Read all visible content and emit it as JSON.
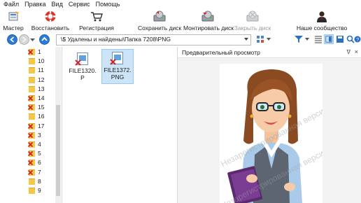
{
  "menu": {
    "items": [
      "Файл",
      "Правка",
      "Вид",
      "Сервис",
      "Помощь"
    ]
  },
  "toolbar": {
    "buttons": [
      {
        "label": "Мастер",
        "icon": "wizard-icon"
      },
      {
        "label": "Восстановить",
        "icon": "lifebuoy-icon"
      },
      {
        "label": "Регистрация",
        "icon": "cart-icon"
      },
      {
        "label": "Сохранить диск",
        "icon": "save-disk-icon"
      },
      {
        "label": "Монтировать диск",
        "icon": "mount-disk-icon"
      },
      {
        "label": "Закрыть диск",
        "icon": "close-disk-icon"
      },
      {
        "label": "Наше сообщество",
        "icon": "community-icon"
      }
    ]
  },
  "address": {
    "path": "\\$ Удалены и найдены\\Папка 7208\\PNG"
  },
  "tree": {
    "items": [
      {
        "label": "1",
        "deleted": true
      },
      {
        "label": "10",
        "deleted": false
      },
      {
        "label": "11",
        "deleted": false
      },
      {
        "label": "12",
        "deleted": false
      },
      {
        "label": "13",
        "deleted": false
      },
      {
        "label": "14",
        "deleted": true
      },
      {
        "label": "15",
        "deleted": true
      },
      {
        "label": "16",
        "deleted": false
      },
      {
        "label": "17",
        "deleted": true
      },
      {
        "label": "3",
        "deleted": true
      },
      {
        "label": "4",
        "deleted": true
      },
      {
        "label": "5",
        "deleted": true
      },
      {
        "label": "6",
        "deleted": true
      },
      {
        "label": "7",
        "deleted": true
      },
      {
        "label": "8",
        "deleted": false
      },
      {
        "label": "9",
        "deleted": false
      }
    ]
  },
  "files": [
    {
      "name": "FILE1320.P",
      "selected": false
    },
    {
      "name": "FILE1372.PNG",
      "selected": true
    }
  ],
  "preview": {
    "title": "Предварительный просмотр",
    "pin": "ᐁ",
    "close": "×",
    "watermark": "Незарегистрированная версия"
  },
  "colors": {
    "accent": "#0078d7",
    "selection": "#cce4f7",
    "folder": "#f5c647",
    "deleted_mark": "#d42020"
  }
}
